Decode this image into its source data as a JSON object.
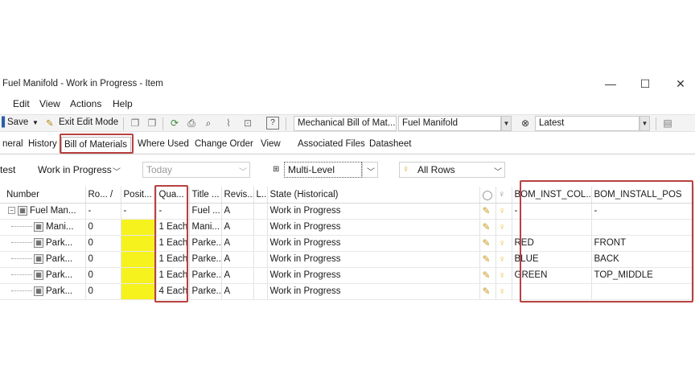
{
  "window": {
    "title": "Fuel Manifold - Work in Progress - Item",
    "minimize_glyph": "—",
    "maximize_glyph": "☐",
    "close_glyph": "✕"
  },
  "menu": [
    "Edit",
    "View",
    "Actions",
    "Help"
  ],
  "toolbar": {
    "save_label": "Save",
    "exit_edit_label": "Exit Edit Mode",
    "bom_type_combo": "Mechanical Bill of Mat...",
    "item_combo": "Fuel Manifold",
    "revision_combo": "Latest"
  },
  "tabs": [
    {
      "label": "neral"
    },
    {
      "label": "History"
    },
    {
      "label": "Bill of Materials"
    },
    {
      "label": "Where Used"
    },
    {
      "label": "Change Order"
    },
    {
      "label": "View"
    },
    {
      "label": "Associated Files"
    },
    {
      "label": "Datasheet"
    }
  ],
  "filters": {
    "prefix": "test",
    "state": "Work in Progress",
    "date": "Today",
    "level": "Multi-Level",
    "rows": "All Rows"
  },
  "grid": {
    "headers": [
      "Number",
      "Ro... /",
      "Posit...",
      "Qua...",
      "Title ...",
      "Revis...",
      "L...",
      "State (Historical)",
      "",
      "",
      "BOM_INST_COL...",
      "BOM_INSTALL_POS"
    ],
    "rows": [
      {
        "number": "Fuel Man...",
        "row": "-",
        "pos": "-",
        "qty": "-",
        "title": "Fuel ...",
        "rev": "A",
        "l": "",
        "state": "Work in Progress",
        "color": "-",
        "install": "-"
      },
      {
        "number": "Mani...",
        "row": "0",
        "pos": "",
        "qty": "1 Each",
        "title": "Mani...",
        "rev": "A",
        "l": "",
        "state": "Work in Progress",
        "color": "",
        "install": ""
      },
      {
        "number": "Park...",
        "row": "0",
        "pos": "",
        "qty": "1 Each",
        "title": "Parke...",
        "rev": "A",
        "l": "",
        "state": "Work in Progress",
        "color": "RED",
        "install": "FRONT"
      },
      {
        "number": "Park...",
        "row": "0",
        "pos": "",
        "qty": "1 Each",
        "title": "Parke...",
        "rev": "A",
        "l": "",
        "state": "Work in Progress",
        "color": "BLUE",
        "install": "BACK"
      },
      {
        "number": "Park...",
        "row": "0",
        "pos": "",
        "qty": "1 Each",
        "title": "Parke...",
        "rev": "A",
        "l": "",
        "state": "Work in Progress",
        "color": "GREEN",
        "install": "TOP_MIDDLE"
      },
      {
        "number": "Park...",
        "row": "0",
        "pos": "",
        "qty": "4 Each",
        "title": "Parke...",
        "rev": "A",
        "l": "",
        "state": "Work in Progress",
        "color": "",
        "install": ""
      }
    ]
  },
  "colors": {
    "highlight": "#b8413f",
    "position_fill": "#f6f21e"
  }
}
